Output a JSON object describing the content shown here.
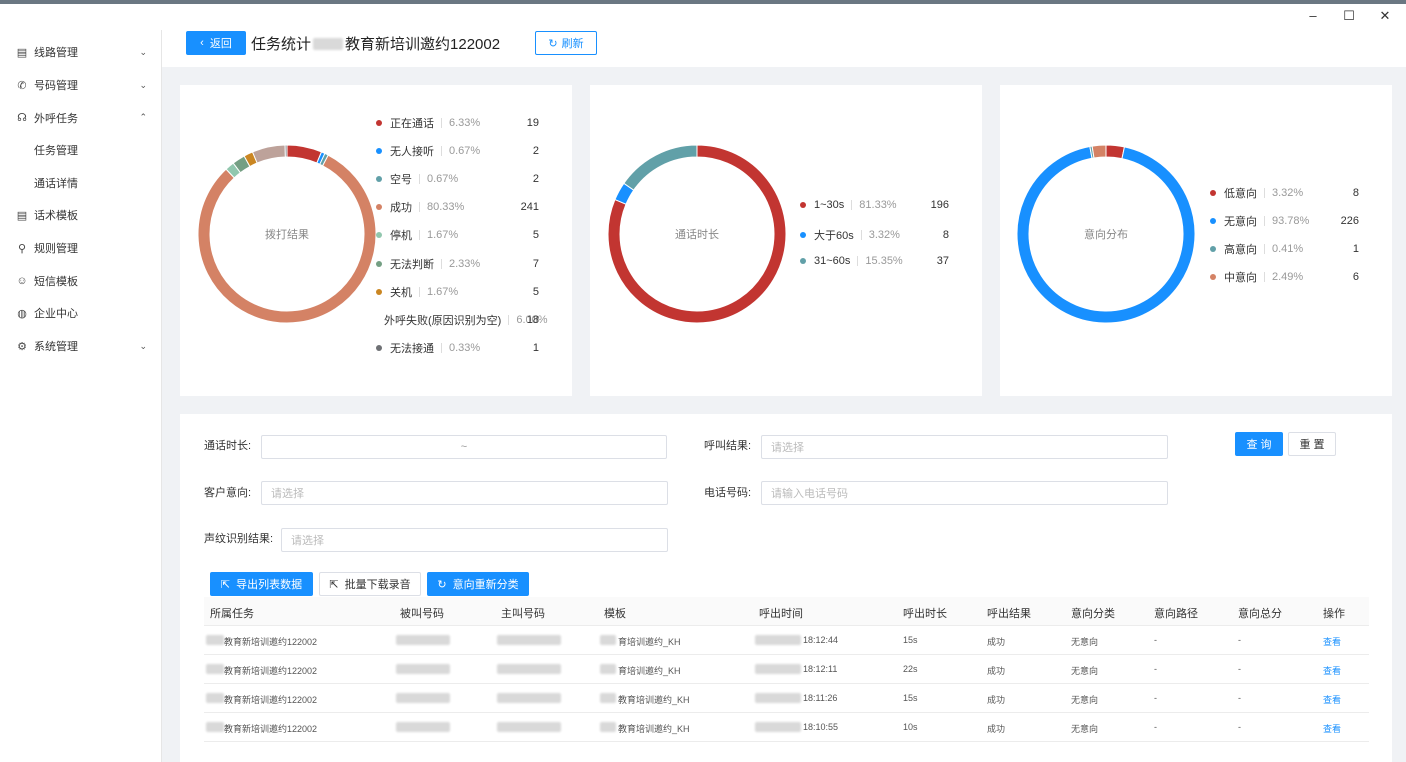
{
  "window": {
    "minimize": "–",
    "maximize": "☐",
    "close": "✕"
  },
  "sidebar": {
    "items": [
      {
        "label": "线路管理",
        "icon": "list-icon",
        "glyph": "▤",
        "chevron": "⌄"
      },
      {
        "label": "号码管理",
        "icon": "phone-icon",
        "glyph": "✆",
        "chevron": "⌄"
      },
      {
        "label": "外呼任务",
        "icon": "headset-icon",
        "glyph": "☊",
        "chevron": "⌃"
      },
      {
        "label": "任务管理",
        "sub": true
      },
      {
        "label": "通话详情",
        "sub": true
      },
      {
        "label": "话术模板",
        "icon": "script-icon",
        "glyph": "▤"
      },
      {
        "label": "规则管理",
        "icon": "link-icon",
        "glyph": "⚲"
      },
      {
        "label": "短信模板",
        "icon": "message-icon",
        "glyph": "☺"
      },
      {
        "label": "企业中心",
        "icon": "globe-icon",
        "glyph": "◍"
      },
      {
        "label": "系统管理",
        "icon": "gear-icon",
        "glyph": "⚙",
        "chevron": "⌄"
      }
    ]
  },
  "header": {
    "back_label": "返回",
    "title_prefix": "任务统计",
    "title_suffix": "教育新培训邀约122002",
    "refresh_label": "刷新"
  },
  "charts": {
    "dial": {
      "center_label": "拨打结果",
      "items": [
        {
          "label": "正在通话",
          "pct": "6.33%",
          "count": "19",
          "color": "#c23531",
          "value": 19
        },
        {
          "label": "无人接听",
          "pct": "0.67%",
          "count": "2",
          "color": "#1890ff",
          "value": 2
        },
        {
          "label": "空号",
          "pct": "0.67%",
          "count": "2",
          "color": "#61a0a8",
          "value": 2
        },
        {
          "label": "成功",
          "pct": "80.33%",
          "count": "241",
          "color": "#d48265",
          "value": 241
        },
        {
          "label": "停机",
          "pct": "1.67%",
          "count": "5",
          "color": "#91c7ae",
          "value": 5
        },
        {
          "label": "无法判断",
          "pct": "2.33%",
          "count": "7",
          "color": "#749f83",
          "value": 7
        },
        {
          "label": "关机",
          "pct": "1.67%",
          "count": "5",
          "color": "#ca8622",
          "value": 5
        },
        {
          "label": "外呼失败(原因识别为空)",
          "pct": "6.00%",
          "count": "18",
          "color": "#bda29a",
          "value": 18
        },
        {
          "label": "无法接通",
          "pct": "0.33%",
          "count": "1",
          "color": "#6e7074",
          "value": 1
        }
      ]
    },
    "duration": {
      "center_label": "通话时长",
      "items": [
        {
          "label": "1~30s",
          "pct": "81.33%",
          "count": "196",
          "color": "#c23531",
          "value": 196
        },
        {
          "label": "大于60s",
          "pct": "3.32%",
          "count": "8",
          "color": "#1890ff",
          "value": 8
        },
        {
          "label": "31~60s",
          "pct": "15.35%",
          "count": "37",
          "color": "#61a0a8",
          "value": 37
        }
      ]
    },
    "intent": {
      "center_label": "意向分布",
      "items": [
        {
          "label": "低意向",
          "pct": "3.32%",
          "count": "8",
          "color": "#c23531",
          "value": 8
        },
        {
          "label": "无意向",
          "pct": "93.78%",
          "count": "226",
          "color": "#1890ff",
          "value": 226
        },
        {
          "label": "高意向",
          "pct": "0.41%",
          "count": "1",
          "color": "#61a0a8",
          "value": 1
        },
        {
          "label": "中意向",
          "pct": "2.49%",
          "count": "6",
          "color": "#d48265",
          "value": 6
        }
      ]
    }
  },
  "filters": {
    "duration_label": "通话时长:",
    "duration_sep": "~",
    "result_label": "呼叫结果:",
    "result_placeholder": "请选择",
    "intent_label": "客户意向:",
    "intent_placeholder": "请选择",
    "phone_label": "电话号码:",
    "phone_placeholder": "请输入电话号码",
    "voiceprint_label": "声纹识别结果:",
    "voiceprint_placeholder": "请选择",
    "query_label": "查 询",
    "reset_label": "重 置"
  },
  "actions": {
    "export_label": "导出列表数据",
    "download_label": "批量下载录音",
    "reclassify_label": "意向重新分类"
  },
  "table": {
    "headers": [
      "所属任务",
      "被叫号码",
      "主叫号码",
      "模板",
      "呼出时间",
      "呼出时长",
      "呼出结果",
      "意向分类",
      "意向路径",
      "意向总分",
      "操作"
    ],
    "rows": [
      {
        "task": "教育新培训邀约122002",
        "template": "育培训邀约_KH",
        "time": "18:12:44",
        "duration": "15s",
        "result": "成功",
        "intent": "无意向",
        "path": "-",
        "score": "-",
        "action": "查看"
      },
      {
        "task": "教育新培训邀约122002",
        "template": "育培训邀约_KH",
        "time": "18:12:11",
        "duration": "22s",
        "result": "成功",
        "intent": "无意向",
        "path": "-",
        "score": "-",
        "action": "查看"
      },
      {
        "task": "教育新培训邀约122002",
        "template": "教育培训邀约_KH",
        "time": "18:11:26",
        "duration": "15s",
        "result": "成功",
        "intent": "无意向",
        "path": "-",
        "score": "-",
        "action": "查看"
      },
      {
        "task": "教育新培训邀约122002",
        "template": "教育培训邀约_KH",
        "time": "18:10:55",
        "duration": "10s",
        "result": "成功",
        "intent": "无意向",
        "path": "-",
        "score": "-",
        "action": "查看"
      }
    ]
  }
}
